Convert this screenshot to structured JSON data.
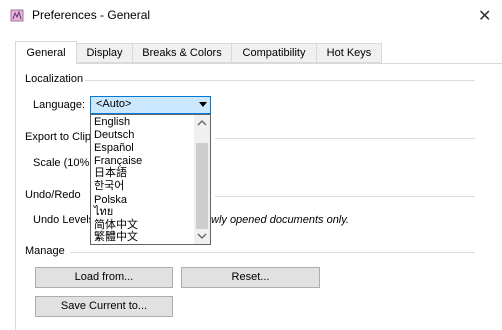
{
  "window": {
    "title": "Preferences - General",
    "close_glyph": "✕",
    "icon": "app-icon"
  },
  "tabs": [
    {
      "label": "General",
      "active": true
    },
    {
      "label": "Display",
      "active": false
    },
    {
      "label": "Breaks & Colors",
      "active": false
    },
    {
      "label": "Compatibility",
      "active": false
    },
    {
      "label": "Hot Keys",
      "active": false
    }
  ],
  "localization": {
    "group_label": "Localization",
    "language_label": "Language:",
    "language_value": "<Auto>",
    "options": [
      "English",
      "Deutsch",
      "Español",
      "Française",
      "日本語",
      "한국어",
      "Polska",
      "ไทย",
      "简体中文",
      "繁體中文"
    ]
  },
  "export": {
    "group_label": "Export to Clip",
    "scale_label": "Scale (10%"
  },
  "undo": {
    "group_label": "Undo/Redo",
    "levels_label": "Undo Levels",
    "note": "wly opened documents only."
  },
  "manage": {
    "group_label": "Manage",
    "load_label": "Load from...",
    "reset_label": "Reset...",
    "save_label": "Save Current to..."
  },
  "colors": {
    "accent": "#0078d7",
    "selection": "#cce8ff"
  }
}
